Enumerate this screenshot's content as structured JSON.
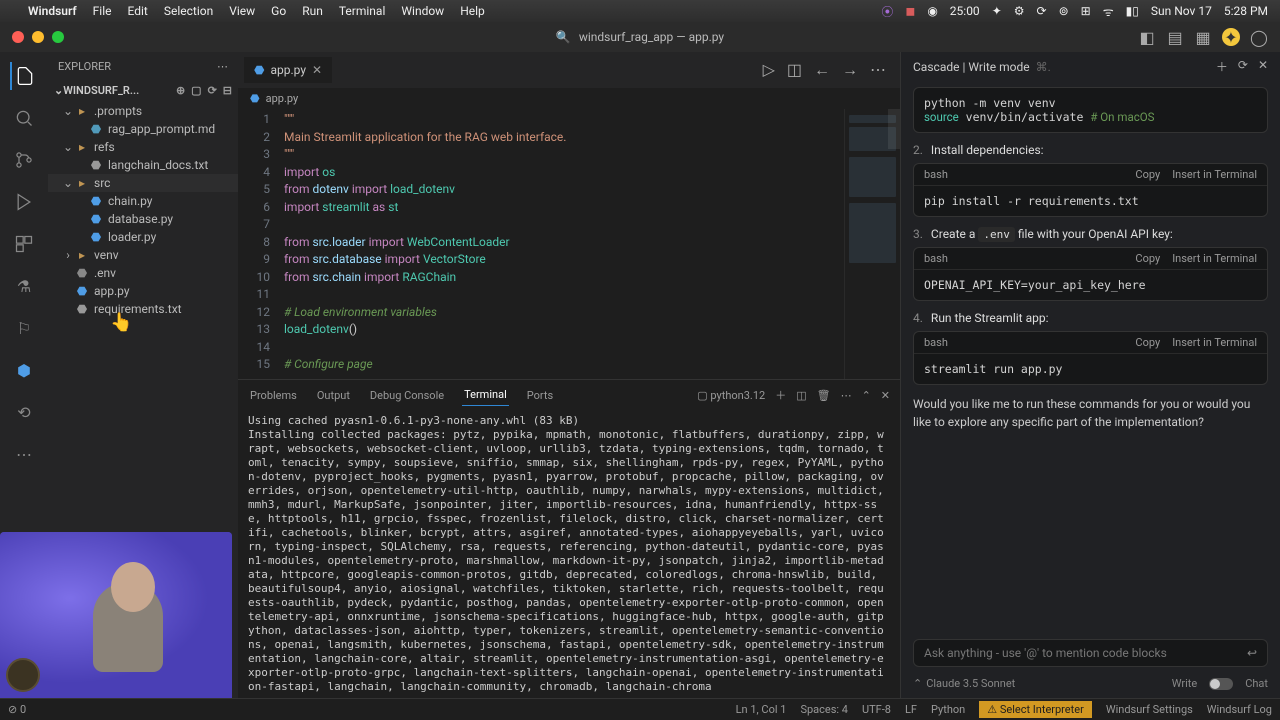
{
  "macMenu": {
    "app": "Windsurf",
    "items": [
      "File",
      "Edit",
      "Selection",
      "View",
      "Go",
      "Run",
      "Terminal",
      "Window",
      "Help"
    ],
    "right": {
      "timer": "25:00",
      "date": "Sun Nov 17",
      "time": "5:28 PM"
    }
  },
  "titlebar": {
    "title": "windsurf_rag_app — app.py"
  },
  "explorer": {
    "title": "Explorer",
    "repo": "windsurf_r...",
    "tree": [
      {
        "type": "folder",
        "open": true,
        "name": ".prompts",
        "depth": 1
      },
      {
        "type": "file",
        "name": "rag_app_prompt.md",
        "depth": 2
      },
      {
        "type": "folder",
        "open": true,
        "name": "refs",
        "depth": 1
      },
      {
        "type": "file",
        "name": "langchain_docs.txt",
        "depth": 2
      },
      {
        "type": "folder",
        "open": true,
        "name": "src",
        "depth": 1,
        "selected": true
      },
      {
        "type": "file",
        "name": "chain.py",
        "depth": 2
      },
      {
        "type": "file",
        "name": "database.py",
        "depth": 2
      },
      {
        "type": "file",
        "name": "loader.py",
        "depth": 2
      },
      {
        "type": "folder",
        "open": false,
        "name": "venv",
        "depth": 1
      },
      {
        "type": "file",
        "name": ".env",
        "depth": 1
      },
      {
        "type": "file",
        "name": "app.py",
        "depth": 1
      },
      {
        "type": "file",
        "name": "requirements.txt",
        "depth": 1
      }
    ]
  },
  "editor": {
    "tab": "app.py",
    "breadcrumb": "app.py",
    "lines": [
      "\"\"\"",
      "Main Streamlit application for the RAG web interface.",
      "\"\"\"",
      "import os",
      "from dotenv import load_dotenv",
      "import streamlit as st",
      "",
      "from src.loader import WebContentLoader",
      "from src.database import VectorStore",
      "from src.chain import RAGChain",
      "",
      "# Load environment variables",
      "load_dotenv()",
      "",
      "# Configure page"
    ]
  },
  "panel": {
    "tabs": [
      "Problems",
      "Output",
      "Debug Console",
      "Terminal",
      "Ports"
    ],
    "active": "Terminal",
    "interpreter": "python3.12",
    "body": "Using cached pyasn1-0.6.1-py3-none-any.whl (83 kB)\nInstalling collected packages: pytz, pypika, mpmath, monotonic, flatbuffers, durationpy, zipp, wrapt, websockets, websocket-client, uvloop, urllib3, tzdata, typing-extensions, tqdm, tornado, toml, tenacity, sympy, soupsieve, sniffio, smmap, six, shellingham, rpds-py, regex, PyYAML, python-dotenv, pyproject_hooks, pygments, pyasn1, pyarrow, protobuf, propcache, pillow, packaging, overrides, orjson, opentelemetry-util-http, oauthlib, numpy, narwhals, mypy-extensions, multidict, mmh3, mdurl, MarkupSafe, jsonpointer, jiter, importlib-resources, idna, humanfriendly, httpx-sse, httptools, h11, grpcio, fsspec, frozenlist, filelock, distro, click, charset-normalizer, certifi, cachetools, blinker, bcrypt, attrs, asgiref, annotated-types, aiohappyeyeballs, yarl, uvicorn, typing-inspect, SQLAlchemy, rsa, requests, referencing, python-dateutil, pydantic-core, pyasn1-modules, opentelemetry-proto, marshmallow, markdown-it-py, jsonpatch, jinja2, importlib-metadata, httpcore, googleapis-common-protos, gitdb, deprecated, coloredlogs, chroma-hnswlib, build, beautifulsoup4, anyio, aiosignal, watchfiles, tiktoken, starlette, rich, requests-toolbelt, requests-oauthlib, pydeck, pydantic, posthog, pandas, opentelemetry-exporter-otlp-proto-common, opentelemetry-api, onnxruntime, jsonschema-specifications, huggingface-hub, httpx, google-auth, gitpython, dataclasses-json, aiohttp, typer, tokenizers, streamlit, opentelemetry-semantic-conventions, openai, langsmith, kubernetes, jsonschema, fastapi, opentelemetry-sdk, opentelemetry-instrumentation, langchain-core, altair, streamlit, opentelemetry-instrumentation-asgi, opentelemetry-exporter-otlp-proto-grpc, langchain-text-splitters, langchain-openai, opentelemetry-instrumentation-fastapi, langchain, langchain-community, chromadb, langchain-chroma"
  },
  "cascade": {
    "title": "Cascade | Write mode",
    "shortcut": "⌘.",
    "blocks": {
      "venv": {
        "lang": "bash",
        "code_html": "python -m venv venv\n<span class='kw2'>source</span> venv/bin/activate  <span class='cm2'># On macOS</span>",
        "copy": "Copy",
        "insert": "Insert in Terminal"
      },
      "pip": {
        "lang": "bash",
        "code": "pip install -r requirements.txt",
        "copy": "Copy",
        "insert": "Insert in Terminal"
      },
      "env": {
        "lang": "bash",
        "code": "OPENAI_API_KEY=your_api_key_here",
        "copy": "Copy",
        "insert": "Insert in Terminal"
      },
      "run": {
        "lang": "bash",
        "code": "streamlit run app.py",
        "copy": "Copy",
        "insert": "Insert in Terminal"
      }
    },
    "step2": {
      "num": "2.",
      "text": "Install dependencies:"
    },
    "step3": {
      "num": "3.",
      "text_pre": "Create a ",
      "code": ".env",
      "text_post": " file with your OpenAI API key:"
    },
    "step4": {
      "num": "4.",
      "text": "Run the Streamlit app:"
    },
    "outro": "Would you like me to run these commands for you or would you like to explore any specific part of the implementation?",
    "placeholder": "Ask anything - use '@' to mention code blocks",
    "model": "Claude 3.5 Sonnet",
    "writeLabel": "Write",
    "chatLabel": "Chat"
  },
  "status": {
    "left": [
      "⊘ 0"
    ],
    "right": [
      "Ln 1, Col 1",
      "Spaces: 4",
      "UTF-8",
      "LF",
      "Python",
      "⚠ Select Interpreter",
      "Windsurf Settings",
      "Windsurf Log"
    ]
  }
}
